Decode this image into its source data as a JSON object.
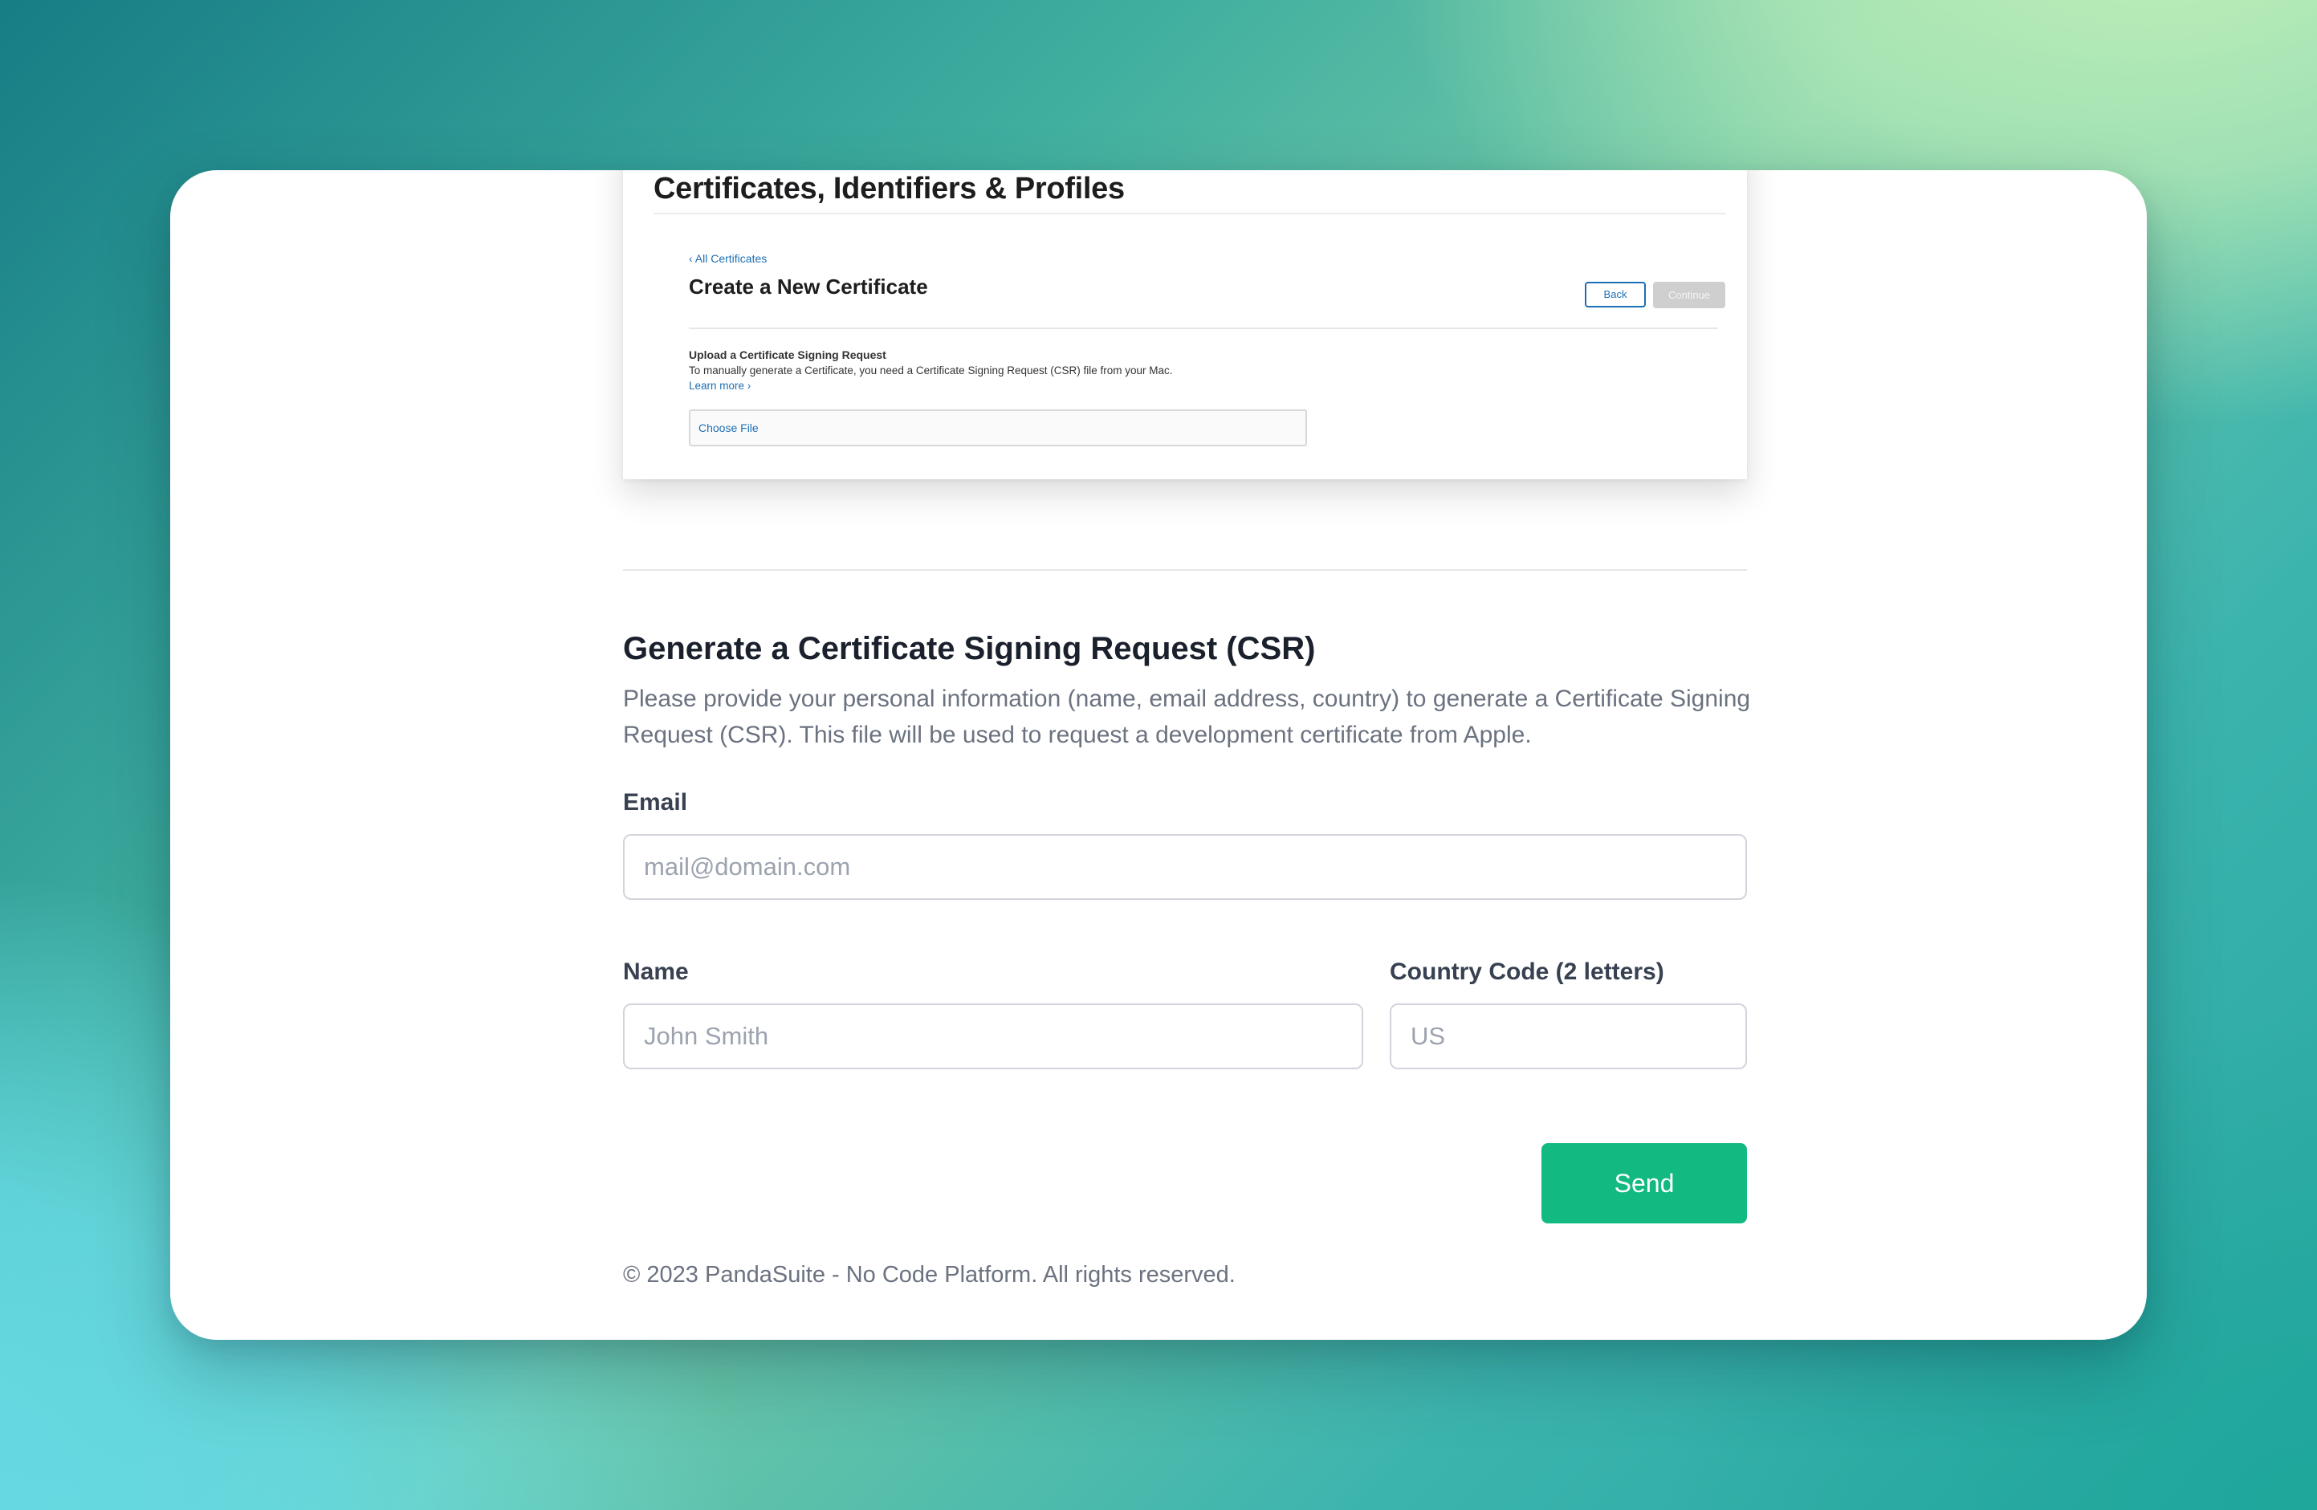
{
  "preview": {
    "title": "Certificates, Identifiers & Profiles",
    "breadcrumb": "‹ All Certificates",
    "heading": "Create a New Certificate",
    "back_label": "Back",
    "continue_label": "Continue",
    "upload_title": "Upload a Certificate Signing Request",
    "upload_desc": "To manually generate a Certificate, you need a Certificate Signing Request (CSR) file from your Mac.",
    "learn_more": "Learn more ›",
    "choose_file": "Choose File"
  },
  "form": {
    "title": "Generate a Certificate Signing Request (CSR)",
    "description": "Please provide your personal information (name, email address, country) to generate a Certificate Signing Request (CSR). This file will be used to request a development certificate from Apple.",
    "email": {
      "label": "Email",
      "placeholder": "mail@domain.com",
      "value": ""
    },
    "name": {
      "label": "Name",
      "placeholder": "John Smith",
      "value": ""
    },
    "country": {
      "label": "Country Code (2 letters)",
      "placeholder": "US",
      "value": ""
    },
    "send_label": "Send"
  },
  "footer": {
    "text": "© 2023 PandaSuite - No Code Platform. All rights reserved."
  },
  "colors": {
    "accent": "#12b981",
    "link": "#1c6fb5"
  }
}
